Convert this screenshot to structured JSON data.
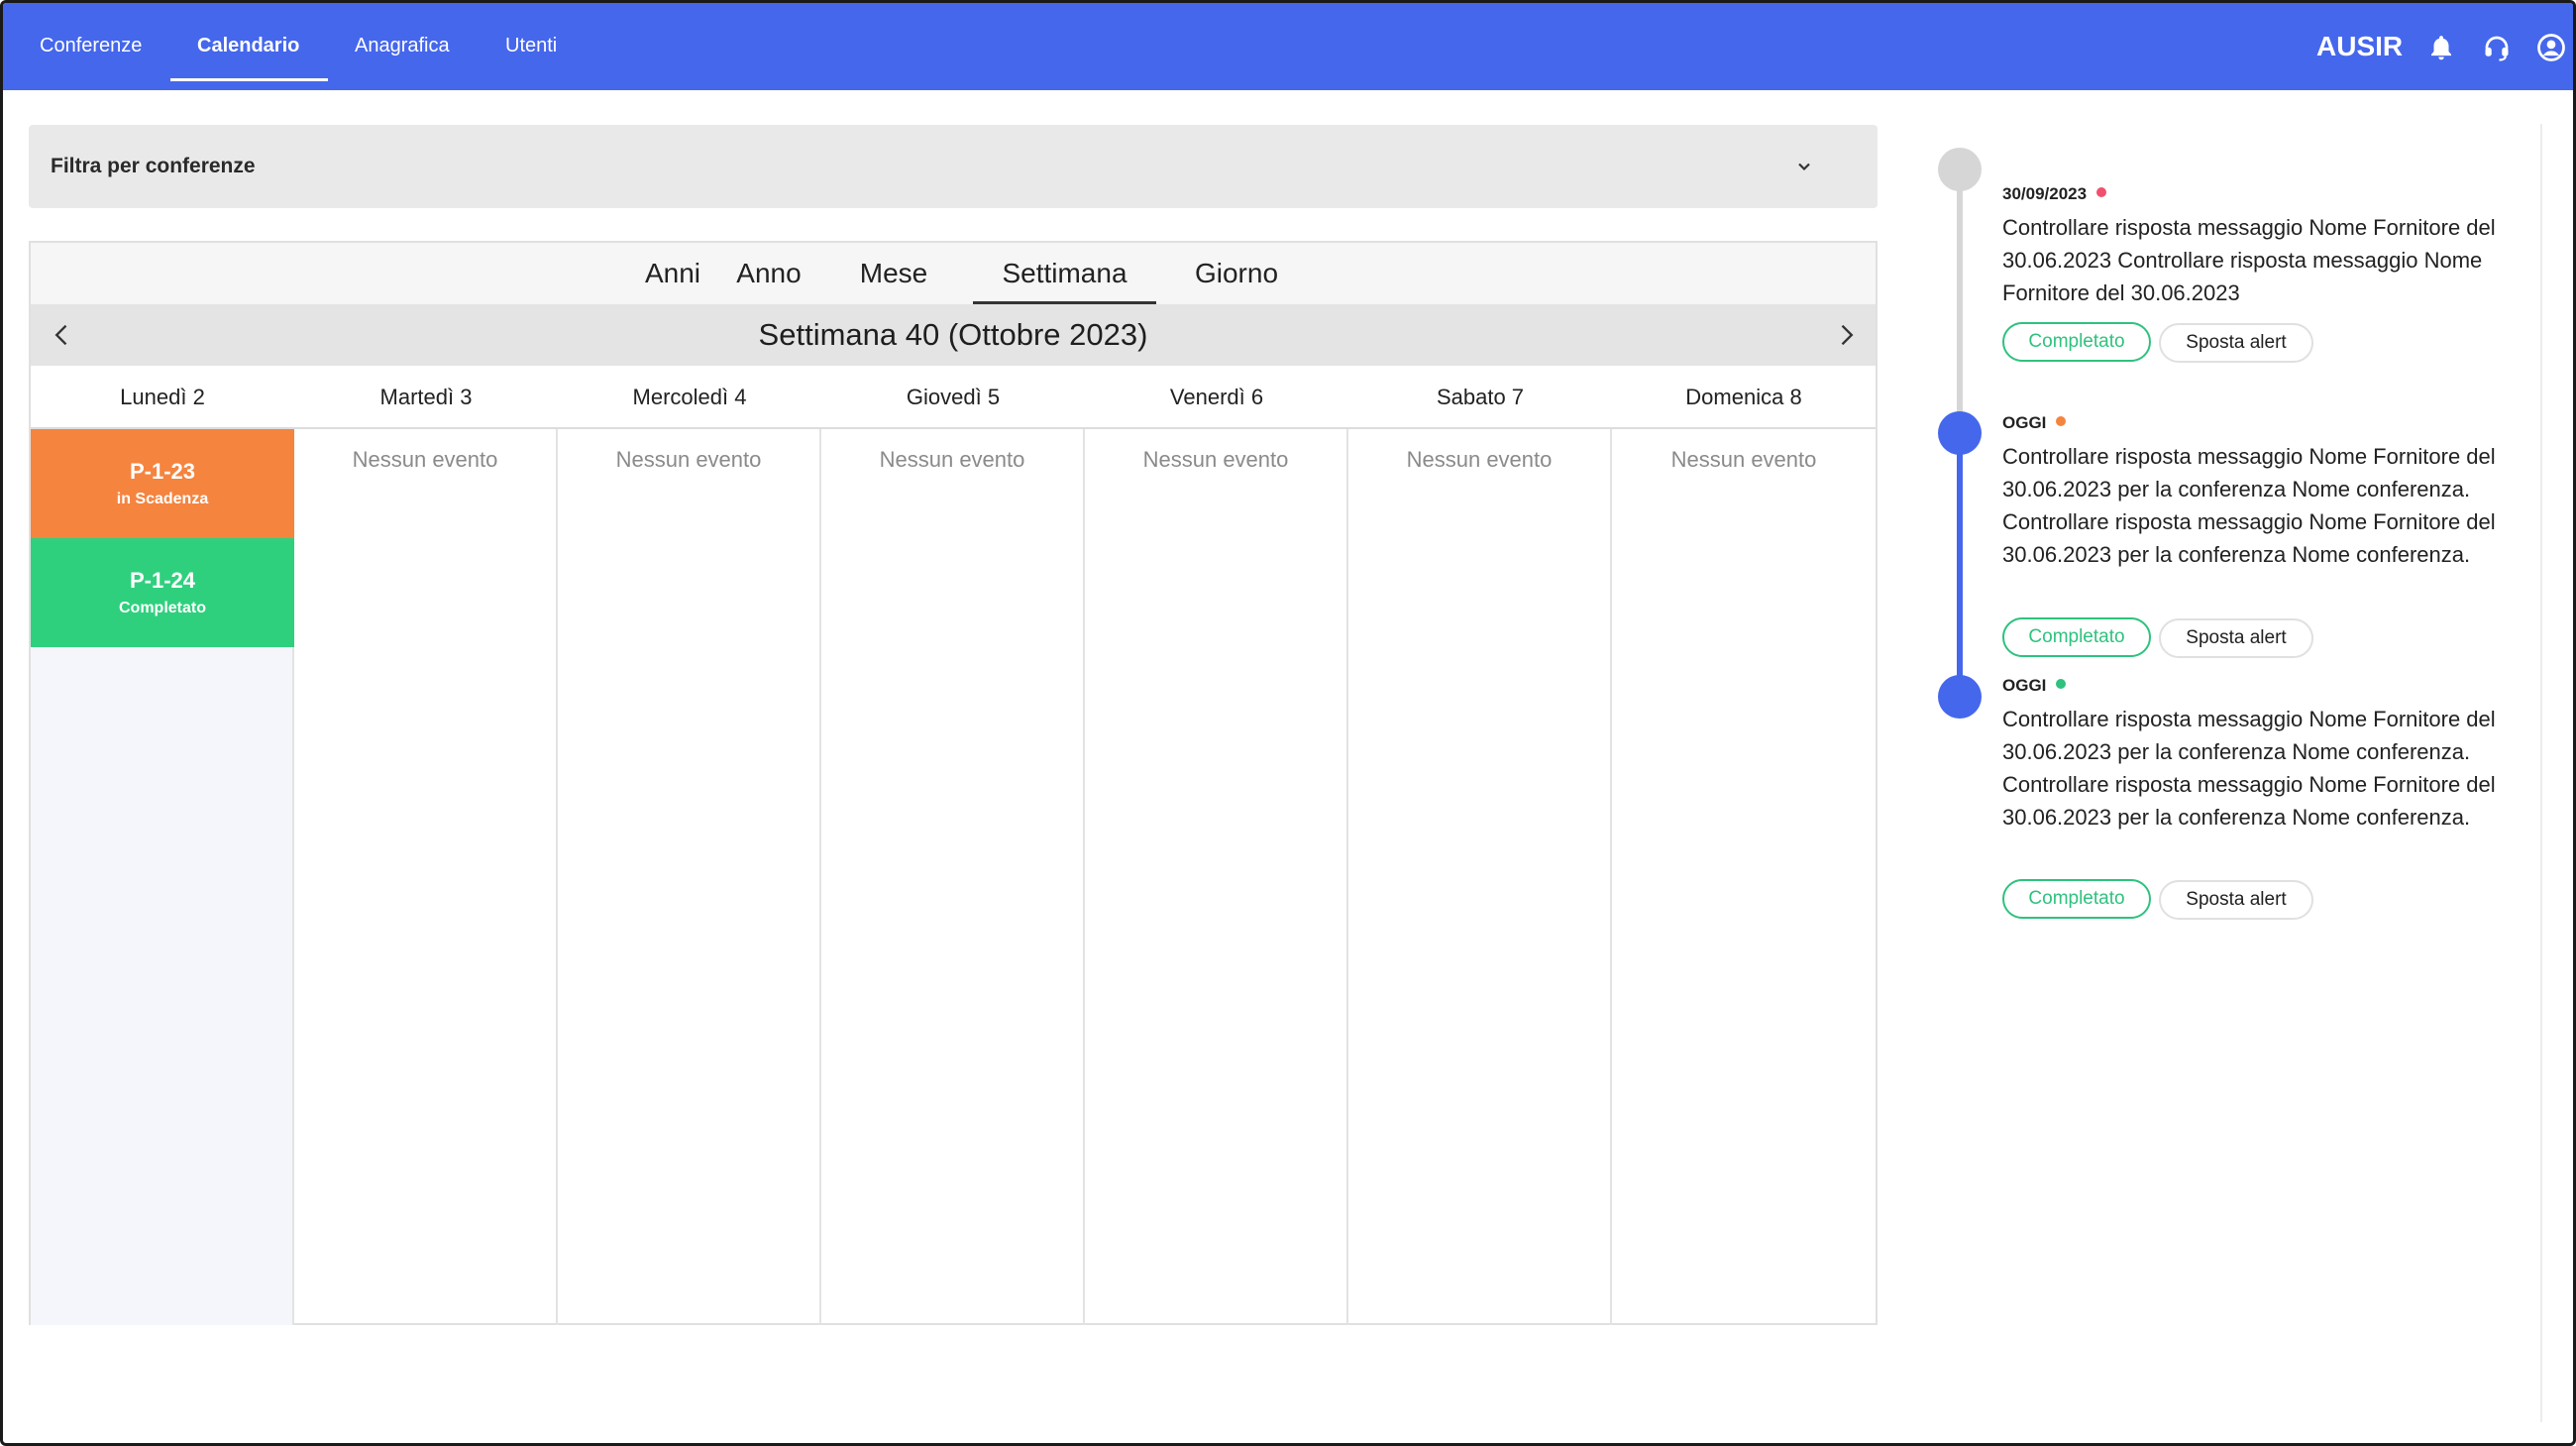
{
  "nav": {
    "items": [
      "Conferenze",
      "Calendario",
      "Anagrafica",
      "Utenti"
    ],
    "active": "Calendario",
    "brand": "AUSIR",
    "icons": [
      "bell-icon",
      "headset-icon",
      "user-icon"
    ],
    "color": "#4567ec"
  },
  "filter": {
    "label": "Filtra per conferenze",
    "icon": "chevron-down-icon"
  },
  "calendar": {
    "views": [
      "Anni",
      "Anno",
      "Mese",
      "Settimana",
      "Giorno"
    ],
    "active_view": "Settimana",
    "week_title": "Settimana 40 (Ottobre 2023)",
    "days": [
      "Lunedì 2",
      "Martedì 3",
      "Mercoledì 4",
      "Giovedì 5",
      "Venerdì 6",
      "Sabato 7",
      "Domenica 8"
    ],
    "no_event_label": "Nessun evento",
    "events": [
      {
        "code": "P-1-23",
        "status": "in Scadenza",
        "color": "#f5843f"
      },
      {
        "code": "P-1-24",
        "status": "Completato",
        "color": "#2fd07d"
      }
    ]
  },
  "timeline": {
    "alerts": [
      {
        "date": "30/09/2023",
        "dot_color": "#f0506e",
        "text": "Controllare risposta messaggio Nome Fornitore del 30.06.2023 Controllare risposta messaggio Nome Fornitore del 30.06.2023",
        "done_label": "Completato",
        "move_label": "Sposta alert"
      },
      {
        "date": "OGGI",
        "dot_color": "#f5843f",
        "text": "Controllare risposta messaggio Nome Fornitore del 30.06.2023 per la conferenza Nome conferenza. Controllare risposta messaggio Nome Fornitore del 30.06.2023 per la conferenza Nome conferenza.",
        "done_label": "Completato",
        "move_label": "Sposta alert"
      },
      {
        "date": "OGGI",
        "dot_color": "#2ec27e",
        "text": "Controllare risposta messaggio Nome Fornitore del 30.06.2023 per la conferenza Nome conferenza. Controllare risposta messaggio Nome Fornitore del 30.06.2023 per la conferenza Nome conferenza.",
        "done_label": "Completato",
        "move_label": "Sposta alert"
      }
    ],
    "past_color": "#d6d6d6",
    "current_color": "#4567ec"
  }
}
